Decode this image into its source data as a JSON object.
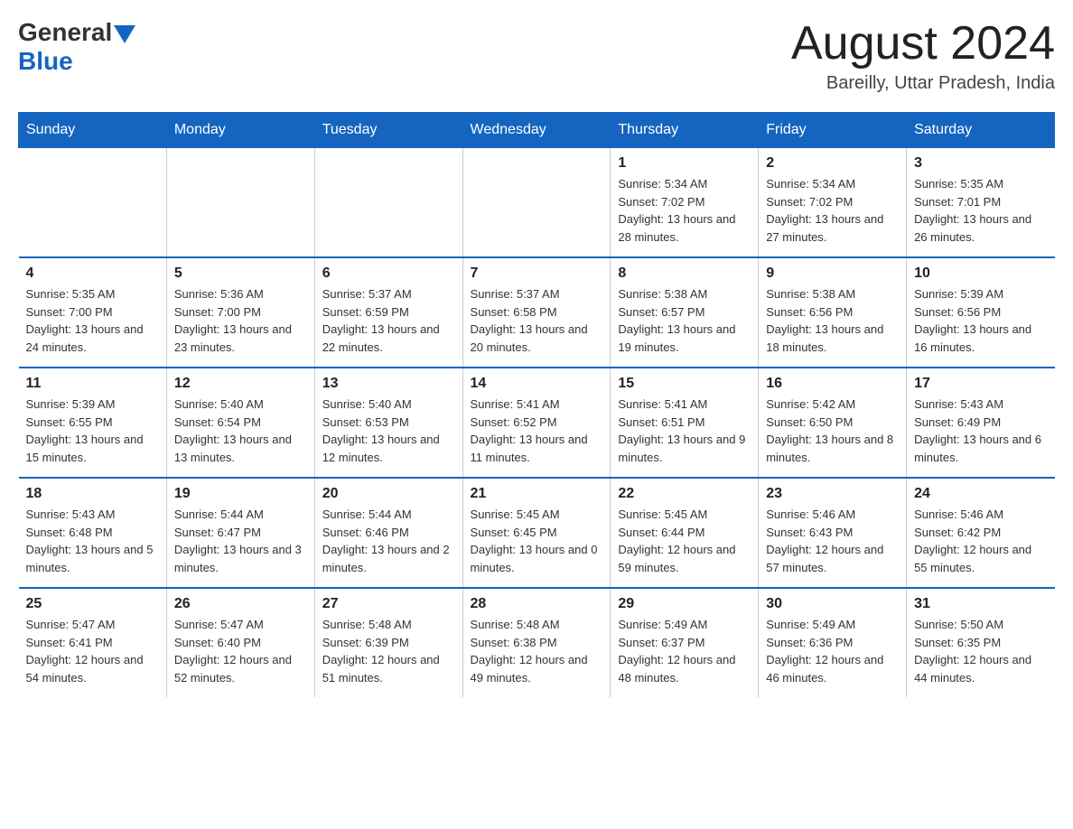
{
  "header": {
    "logo_general": "General",
    "logo_blue": "Blue",
    "month_title": "August 2024",
    "location": "Bareilly, Uttar Pradesh, India"
  },
  "days_of_week": [
    "Sunday",
    "Monday",
    "Tuesday",
    "Wednesday",
    "Thursday",
    "Friday",
    "Saturday"
  ],
  "weeks": [
    [
      {
        "day": "",
        "info": ""
      },
      {
        "day": "",
        "info": ""
      },
      {
        "day": "",
        "info": ""
      },
      {
        "day": "",
        "info": ""
      },
      {
        "day": "1",
        "info": "Sunrise: 5:34 AM\nSunset: 7:02 PM\nDaylight: 13 hours and 28 minutes."
      },
      {
        "day": "2",
        "info": "Sunrise: 5:34 AM\nSunset: 7:02 PM\nDaylight: 13 hours and 27 minutes."
      },
      {
        "day": "3",
        "info": "Sunrise: 5:35 AM\nSunset: 7:01 PM\nDaylight: 13 hours and 26 minutes."
      }
    ],
    [
      {
        "day": "4",
        "info": "Sunrise: 5:35 AM\nSunset: 7:00 PM\nDaylight: 13 hours and 24 minutes."
      },
      {
        "day": "5",
        "info": "Sunrise: 5:36 AM\nSunset: 7:00 PM\nDaylight: 13 hours and 23 minutes."
      },
      {
        "day": "6",
        "info": "Sunrise: 5:37 AM\nSunset: 6:59 PM\nDaylight: 13 hours and 22 minutes."
      },
      {
        "day": "7",
        "info": "Sunrise: 5:37 AM\nSunset: 6:58 PM\nDaylight: 13 hours and 20 minutes."
      },
      {
        "day": "8",
        "info": "Sunrise: 5:38 AM\nSunset: 6:57 PM\nDaylight: 13 hours and 19 minutes."
      },
      {
        "day": "9",
        "info": "Sunrise: 5:38 AM\nSunset: 6:56 PM\nDaylight: 13 hours and 18 minutes."
      },
      {
        "day": "10",
        "info": "Sunrise: 5:39 AM\nSunset: 6:56 PM\nDaylight: 13 hours and 16 minutes."
      }
    ],
    [
      {
        "day": "11",
        "info": "Sunrise: 5:39 AM\nSunset: 6:55 PM\nDaylight: 13 hours and 15 minutes."
      },
      {
        "day": "12",
        "info": "Sunrise: 5:40 AM\nSunset: 6:54 PM\nDaylight: 13 hours and 13 minutes."
      },
      {
        "day": "13",
        "info": "Sunrise: 5:40 AM\nSunset: 6:53 PM\nDaylight: 13 hours and 12 minutes."
      },
      {
        "day": "14",
        "info": "Sunrise: 5:41 AM\nSunset: 6:52 PM\nDaylight: 13 hours and 11 minutes."
      },
      {
        "day": "15",
        "info": "Sunrise: 5:41 AM\nSunset: 6:51 PM\nDaylight: 13 hours and 9 minutes."
      },
      {
        "day": "16",
        "info": "Sunrise: 5:42 AM\nSunset: 6:50 PM\nDaylight: 13 hours and 8 minutes."
      },
      {
        "day": "17",
        "info": "Sunrise: 5:43 AM\nSunset: 6:49 PM\nDaylight: 13 hours and 6 minutes."
      }
    ],
    [
      {
        "day": "18",
        "info": "Sunrise: 5:43 AM\nSunset: 6:48 PM\nDaylight: 13 hours and 5 minutes."
      },
      {
        "day": "19",
        "info": "Sunrise: 5:44 AM\nSunset: 6:47 PM\nDaylight: 13 hours and 3 minutes."
      },
      {
        "day": "20",
        "info": "Sunrise: 5:44 AM\nSunset: 6:46 PM\nDaylight: 13 hours and 2 minutes."
      },
      {
        "day": "21",
        "info": "Sunrise: 5:45 AM\nSunset: 6:45 PM\nDaylight: 13 hours and 0 minutes."
      },
      {
        "day": "22",
        "info": "Sunrise: 5:45 AM\nSunset: 6:44 PM\nDaylight: 12 hours and 59 minutes."
      },
      {
        "day": "23",
        "info": "Sunrise: 5:46 AM\nSunset: 6:43 PM\nDaylight: 12 hours and 57 minutes."
      },
      {
        "day": "24",
        "info": "Sunrise: 5:46 AM\nSunset: 6:42 PM\nDaylight: 12 hours and 55 minutes."
      }
    ],
    [
      {
        "day": "25",
        "info": "Sunrise: 5:47 AM\nSunset: 6:41 PM\nDaylight: 12 hours and 54 minutes."
      },
      {
        "day": "26",
        "info": "Sunrise: 5:47 AM\nSunset: 6:40 PM\nDaylight: 12 hours and 52 minutes."
      },
      {
        "day": "27",
        "info": "Sunrise: 5:48 AM\nSunset: 6:39 PM\nDaylight: 12 hours and 51 minutes."
      },
      {
        "day": "28",
        "info": "Sunrise: 5:48 AM\nSunset: 6:38 PM\nDaylight: 12 hours and 49 minutes."
      },
      {
        "day": "29",
        "info": "Sunrise: 5:49 AM\nSunset: 6:37 PM\nDaylight: 12 hours and 48 minutes."
      },
      {
        "day": "30",
        "info": "Sunrise: 5:49 AM\nSunset: 6:36 PM\nDaylight: 12 hours and 46 minutes."
      },
      {
        "day": "31",
        "info": "Sunrise: 5:50 AM\nSunset: 6:35 PM\nDaylight: 12 hours and 44 minutes."
      }
    ]
  ]
}
